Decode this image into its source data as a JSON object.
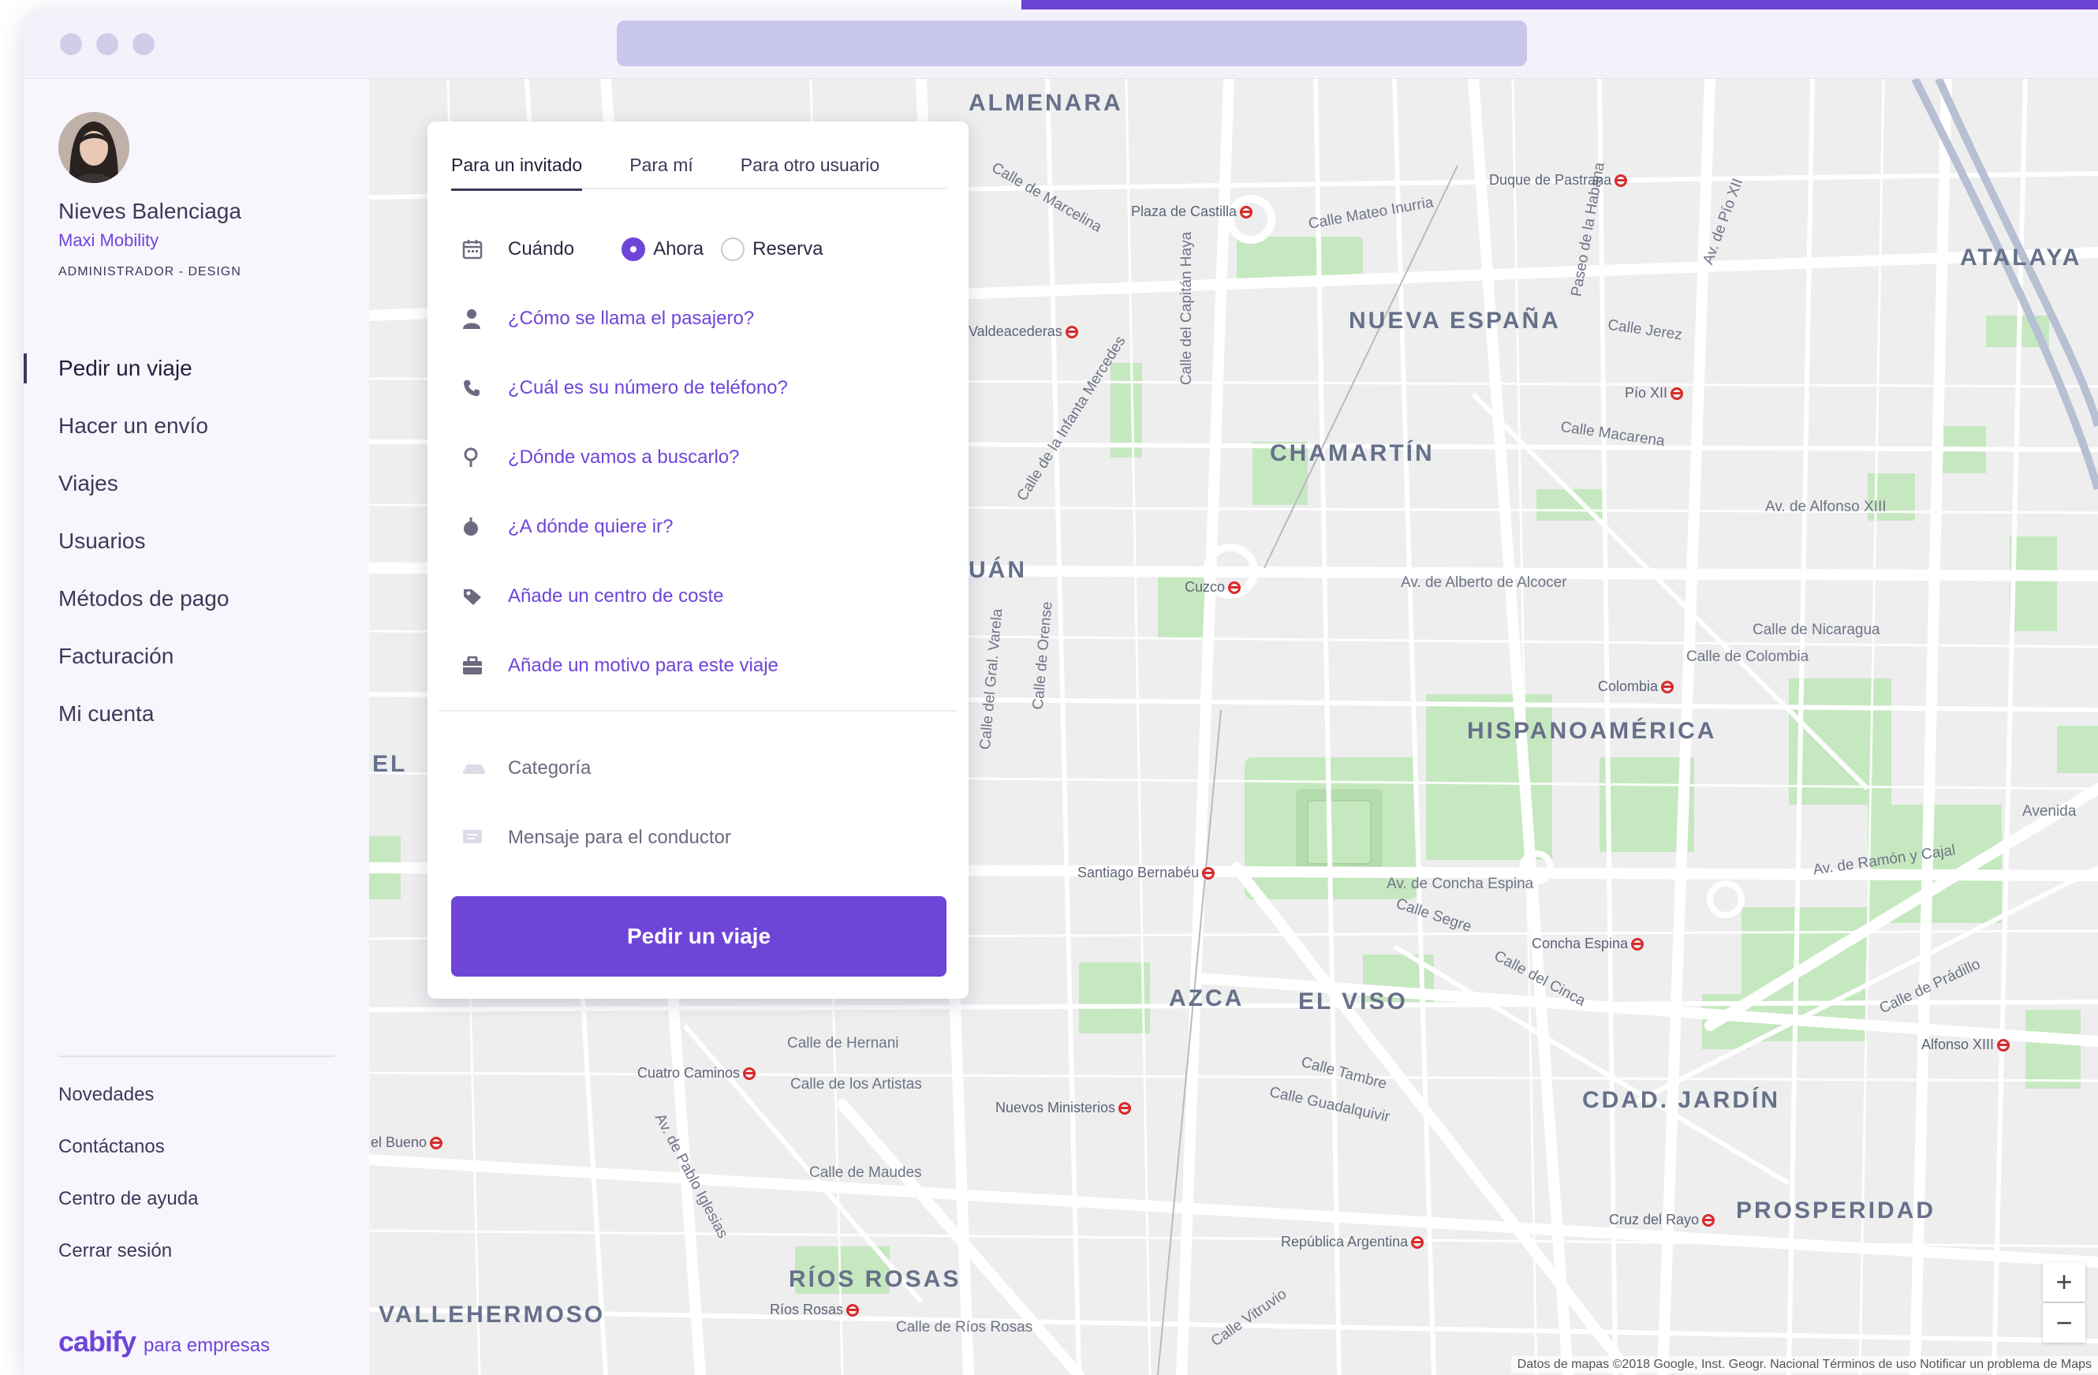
{
  "browser": {
    "address": ""
  },
  "user": {
    "name": "Nieves Balenciaga",
    "company": "Maxi Mobility",
    "role": "ADMINISTRADOR - DESIGN"
  },
  "nav": {
    "items": [
      "Pedir un viaje",
      "Hacer un envío",
      "Viajes",
      "Usuarios",
      "Métodos de pago",
      "Facturación",
      "Mi cuenta"
    ],
    "active": "Pedir un viaje"
  },
  "footer_nav": [
    "Novedades",
    "Contáctanos",
    "Centro de ayuda",
    "Cerrar sesión"
  ],
  "brand": {
    "logo": "cabify",
    "suffix": "para empresas"
  },
  "form": {
    "tabs": [
      "Para un invitado",
      "Para mí",
      "Para otro usuario"
    ],
    "active_tab": "Para un invitado",
    "when_label": "Cuándo",
    "when_options": [
      "Ahora",
      "Reserva"
    ],
    "when_selected": "Ahora",
    "passenger_name": "¿Cómo se llama el pasajero?",
    "phone": "¿Cuál es su número de teléfono?",
    "pickup": "¿Dónde vamos a buscarlo?",
    "destination": "¿A dónde quiere ir?",
    "cost_center": "Añade un centro de coste",
    "reason": "Añade un motivo para este viaje",
    "category": "Categoría",
    "driver_message": "Mensaje para el conductor",
    "submit": "Pedir un viaje",
    "icons": [
      "calendar-icon",
      "person-icon",
      "phone-icon",
      "location-pin-icon",
      "destination-icon",
      "tag-icon",
      "briefcase-icon",
      "car-icon",
      "message-icon"
    ]
  },
  "map": {
    "districts": [
      "ALMENARA",
      "NUEVA ESPAÑA",
      "ATALAYA",
      "CHAMARTÍN",
      "HISPANOAMÉRICA",
      "AZCA",
      "EL VISO",
      "CDAD. JARDÍN",
      "PROSPERIDAD",
      "RÍOS ROSAS",
      "VALLEHERMOSO",
      "UÁN",
      "EL"
    ],
    "streets": [
      "Calle Mateo Inurria",
      "Calle Jerez",
      "Calle Macarena",
      "Av. de Alfonso XIII",
      "Av. de Alberto de Alcocer",
      "Calle de Nicaragua",
      "Calle de Colombia",
      "Av. de Concha Espina",
      "Av. de Ramón y Cajal",
      "Calle de Hernani",
      "Calle de Maudes",
      "Calle de Ríos Rosas",
      "Calle Tambre",
      "Calle Segre",
      "Calle del Cinca",
      "Calle de Prádillo",
      "Calle del Capitán Haya",
      "Paseo de la Habana",
      "Av. de Pío XII",
      "Calle de Orense",
      "Calle del Gral. Varela",
      "Calle de la Infanta Mercedes",
      "Av. de Pablo Iglesias",
      "Calle Vitruvio",
      "Calle de los Artistas",
      "Calle Guadalquivir",
      "Avenida",
      "Calle de Marcelina"
    ],
    "metro_stations": [
      "Duque de Pastrana",
      "Plaza de Castilla",
      "Pío XII",
      "Cuzco",
      "Colombia",
      "Santiago Bernabéu",
      "Concha Espina",
      "Alfonso XIII",
      "Cuatro Caminos",
      "Nuevos Ministerios",
      "Cruz del Rayo",
      "República Argentina",
      "Ríos Rosas",
      "Valdeacederas",
      "el Bueno"
    ],
    "zoom_in": "+",
    "zoom_out": "−",
    "attribution": "Datos de mapas ©2018 Google, Inst. Geogr. Nacional   Términos de uso   Notificar un problema de Maps"
  },
  "colors": {
    "accent": "#6f45d8",
    "text": "#3b3a59",
    "sidebar_bg": "#f7f6fd",
    "map_bg": "#eeeeef",
    "park": "#c6e8c0"
  }
}
